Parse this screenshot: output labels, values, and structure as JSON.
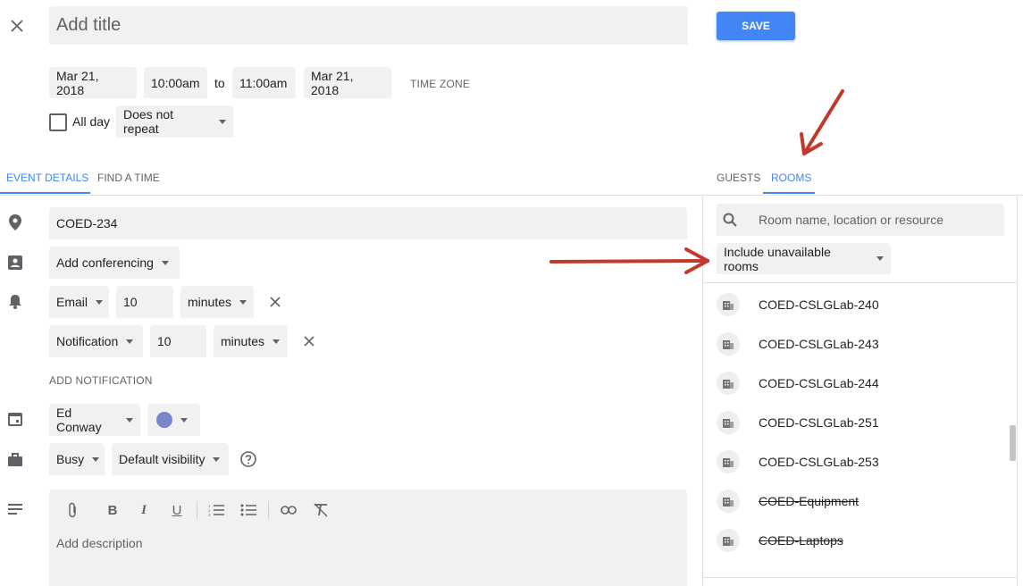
{
  "header": {
    "title_placeholder": "Add title",
    "save_label": "SAVE",
    "start_date": "Mar 21, 2018",
    "start_time": "10:00am",
    "to_label": "to",
    "end_time": "11:00am",
    "end_date": "Mar 21, 2018",
    "time_zone_label": "TIME ZONE",
    "all_day_label": "All day",
    "repeat_value": "Does not repeat"
  },
  "tabs": {
    "event_details": "EVENT DETAILS",
    "find_a_time": "FIND A TIME",
    "guests": "GUESTS",
    "rooms": "ROOMS"
  },
  "details": {
    "location_value": "COED-234",
    "conferencing_label": "Add conferencing",
    "notifications": [
      {
        "method": "Email",
        "amount": "10",
        "unit": "minutes"
      },
      {
        "method": "Notification",
        "amount": "10",
        "unit": "minutes"
      }
    ],
    "add_notification_label": "ADD NOTIFICATION",
    "calendar_owner": "Ed Conway",
    "event_color": "#7986cb",
    "availability": "Busy",
    "visibility": "Default visibility",
    "description_placeholder": "Add description"
  },
  "rooms_panel": {
    "search_placeholder": "Room name, location or resource",
    "filter_label": "Include unavailable rooms",
    "rooms": [
      {
        "name": "COED-CSLGLab-240",
        "unavailable": false
      },
      {
        "name": "COED-CSLGLab-243",
        "unavailable": false
      },
      {
        "name": "COED-CSLGLab-244",
        "unavailable": false
      },
      {
        "name": "COED-CSLGLab-251",
        "unavailable": false
      },
      {
        "name": "COED-CSLGLab-253",
        "unavailable": false
      },
      {
        "name": "COED-Equipment",
        "unavailable": true
      },
      {
        "name": "COED-Laptops",
        "unavailable": true
      }
    ]
  },
  "colors": {
    "accent_blue": "#4285f4",
    "annotation_arrow": "#c0392b"
  }
}
